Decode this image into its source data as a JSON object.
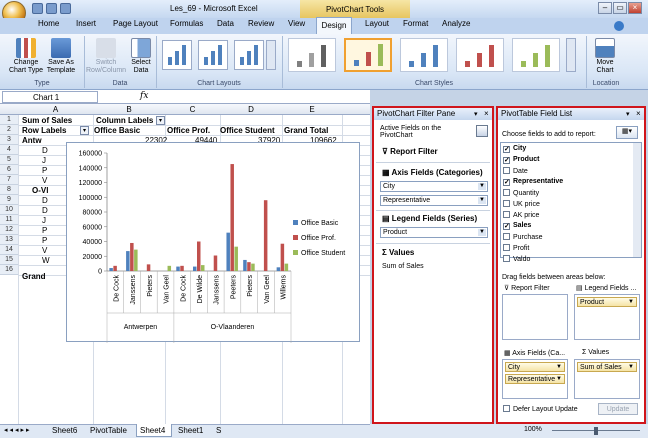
{
  "window": {
    "title": "Les_69 - Microsoft Excel",
    "context_tab": "PivotChart Tools"
  },
  "tabs": [
    "Home",
    "Insert",
    "Page Layout",
    "Formulas",
    "Data",
    "Review",
    "View",
    "Design",
    "Layout",
    "Format",
    "Analyze"
  ],
  "active_tab": "Design",
  "ribbon": {
    "type_group": {
      "label": "Type",
      "change_chart_type": "Change Chart Type",
      "save_as_template": "Save As Template"
    },
    "data_group": {
      "label": "Data",
      "switch_row_column": "Switch Row/Column",
      "select_data": "Select Data"
    },
    "chart_layouts_label": "Chart Layouts",
    "chart_styles_label": "Chart Styles",
    "location_group": {
      "label": "Location",
      "move_chart": "Move Chart"
    }
  },
  "name_box": "Chart 1",
  "fx": "fx",
  "columns": [
    "A",
    "B",
    "C",
    "D",
    "E"
  ],
  "rows": [
    "1",
    "2",
    "3",
    "4",
    "5",
    "6",
    "7",
    "8",
    "9",
    "10",
    "11",
    "12",
    "13",
    "14",
    "15",
    "16",
    "17",
    "18",
    "19",
    "20",
    "21",
    "22",
    "23",
    "24",
    "25",
    "26",
    "27",
    "28",
    "29",
    "30",
    "31"
  ],
  "cells": {
    "a1": "Sum of Sales",
    "b1": "Column Labels",
    "a2": "Row Labels",
    "b2": "Office Basic",
    "c2": "Office Prof.",
    "d2": "Office Student",
    "e2": "Grand Total",
    "a3": "Antw",
    "b3": "22302",
    "c3": "49440",
    "d3": "37920",
    "e3": "109662",
    "a4": "D",
    "a5": "J",
    "a6": "P",
    "a7": "V",
    "a8": "O-Vl",
    "a9": "D",
    "a10": "D",
    "a11": "J",
    "a12": "P",
    "a13": "P",
    "a14": "V",
    "a15": "W",
    "a16": "Grand"
  },
  "chart_data": {
    "type": "bar",
    "groups": [
      {
        "name": "Antwerpen",
        "categories": [
          "De Cock",
          "Janssens",
          "Pieters",
          "Van Geel"
        ]
      },
      {
        "name": "O-Vlaanderen",
        "categories": [
          "De Cock",
          "De Wilde",
          "Janssens",
          "Peeters",
          "Pieters",
          "Van Geel",
          "Willems"
        ]
      }
    ],
    "categories": [
      "De Cock",
      "Janssens",
      "Pieters",
      "Van Geel",
      "De Cock",
      "De Wilde",
      "Janssens",
      "Peeters",
      "Pieters",
      "Van Geel",
      "Willems"
    ],
    "series": [
      {
        "name": "Office Basic",
        "color": "#4f81bd",
        "values": [
          4000,
          27000,
          0,
          0,
          6000,
          6000,
          0,
          52000,
          15000,
          0,
          5000
        ]
      },
      {
        "name": "Office Prof.",
        "color": "#c0504d",
        "values": [
          7000,
          38000,
          9000,
          0,
          7000,
          40000,
          21000,
          145000,
          12000,
          96000,
          37000
        ]
      },
      {
        "name": "Office Student",
        "color": "#9bbb59",
        "values": [
          0,
          29000,
          0,
          7000,
          0,
          8000,
          0,
          33000,
          10000,
          0,
          10000
        ]
      }
    ],
    "ylim": [
      0,
      160000
    ],
    "yticks": [
      "0",
      "20000",
      "40000",
      "60000",
      "80000",
      "100000",
      "120000",
      "140000",
      "160000"
    ],
    "legend": "right"
  },
  "filter_pane": {
    "title": "PivotChart Filter Pane",
    "active_fields": "Active Fields on the PivotChart",
    "report_filter": "Report Filter",
    "axis_fields": "Axis Fields (Categories)",
    "axis_values": [
      "City",
      "Representative"
    ],
    "legend_fields": "Legend Fields (Series)",
    "legend_values": [
      "Product"
    ],
    "values": "Values",
    "values_item": "Sum of Sales"
  },
  "field_list": {
    "title": "PivotTable Field List",
    "choose": "Choose fields to add to report:",
    "fields": [
      {
        "name": "City",
        "checked": true
      },
      {
        "name": "Product",
        "checked": true
      },
      {
        "name": "Date",
        "checked": false
      },
      {
        "name": "Representative",
        "checked": true
      },
      {
        "name": "Quantity",
        "checked": false
      },
      {
        "name": "UK price",
        "checked": false
      },
      {
        "name": "AK price",
        "checked": false
      },
      {
        "name": "Sales",
        "checked": true
      },
      {
        "name": "Purchase",
        "checked": false
      },
      {
        "name": "Profit",
        "checked": false
      },
      {
        "name": "Valdo",
        "checked": false
      }
    ],
    "drag": "Drag fields between areas below:",
    "report_filter": "Report Filter",
    "legend_fields": "Legend Fields ...",
    "legend_item": "Product",
    "axis_fields": "Axis Fields (Ca...",
    "values": "Values",
    "axis_items": [
      "City",
      "Representative"
    ],
    "values_item": "Sum of Sales",
    "defer": "Defer Layout Update",
    "update": "Update"
  },
  "sheet_tabs": [
    "Sheet6",
    "PivotTable",
    "Sheet4",
    "Sheet1",
    "S"
  ],
  "active_sheet": "Sheet4",
  "zoom": "100%"
}
